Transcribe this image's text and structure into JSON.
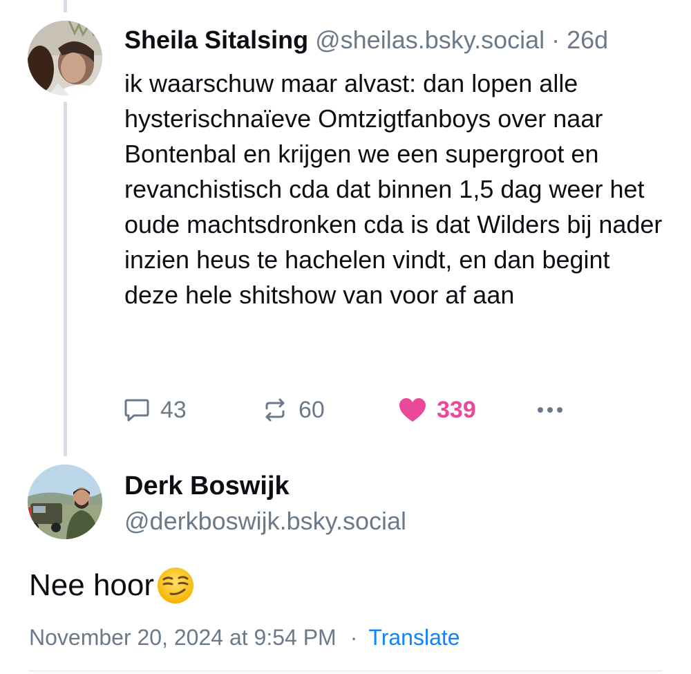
{
  "parent_post": {
    "author": {
      "display_name": "Sheila Sitalsing",
      "handle": "@sheilas.bsky.social",
      "avatar_icon": "avatar-photo"
    },
    "separator": "·",
    "age": "26d",
    "text": "ik waarschuw maar alvast: dan lopen alle hysterischnaïeve Omtzigtfanboys over naar Bontenbal en krijgen we een supergroot en revanchistisch cda dat binnen 1,5 dag weer het oude machtsdronken cda is dat Wilders bij nader inzien heus te hachelen vindt, en dan begint deze hele shitshow van voor af aan",
    "actions": {
      "reply_count": "43",
      "repost_count": "60",
      "like_count": "339",
      "reply_icon": "speech-bubble-icon",
      "repost_icon": "repost-arrows-icon",
      "like_icon": "heart-icon",
      "more_icon": "ellipsis-icon"
    },
    "like_color": "#ec4899"
  },
  "main_post": {
    "author": {
      "display_name": "Derk Boswijk",
      "handle": "@derkboswijk.bsky.social",
      "avatar_icon": "avatar-photo"
    },
    "text": "Nee hoor",
    "emoji": "smirking-face",
    "timestamp": "November 20, 2024 at 9:54 PM",
    "separator": "·",
    "translate_label": "Translate",
    "link_color": "#1083fe"
  },
  "colors": {
    "muted_text": "#6b7a8a",
    "thread_line": "#d4dbe2"
  }
}
